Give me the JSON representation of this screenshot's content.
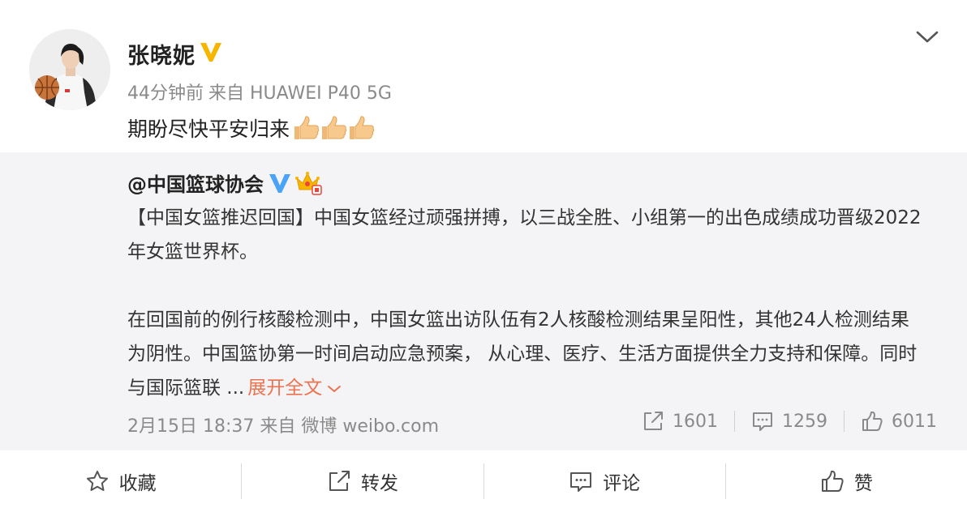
{
  "post": {
    "author": "张晓妮",
    "time": "44分钟前",
    "source": "来自 HUAWEI P40 5G",
    "text": "期盼尽快平安归来",
    "emoji_count": 3
  },
  "retweet": {
    "author": "@中国篮球协会",
    "paragraph1": "【中国女篮推迟回国】中国女篮经过顽强拼搏，以三战全胜、小组第一的出色成绩成功晋级2022年女篮世界杯。",
    "paragraph2": "在回国前的例行核酸检测中，中国女篮出访队伍有2人核酸检测结果呈阳性，其他24人检测结果为阴性。中国篮协第一时间启动应急预案， 从心理、医疗、生活方面提供全力支持和保障。同时与国际篮联 ...",
    "expand_label": "展开全文",
    "timestamp": "2月15日 18:37 来自 微博 weibo.com",
    "reposts": "1601",
    "comments": "1259",
    "likes": "6011"
  },
  "actions": {
    "favorite": "收藏",
    "repost": "转发",
    "comment": "评论",
    "like": "赞"
  },
  "colors": {
    "accent": "#eb7350",
    "vip_gold": "#f7b500",
    "vip_blue": "#4aa3f4",
    "retweet_bg": "#f4f4f6",
    "meta_gray": "#8a8a8a"
  },
  "icons": [
    "chevron-down-icon",
    "vip-badge-icon",
    "thumbs-up-emoji",
    "crown-icon",
    "repost-icon",
    "comment-icon",
    "like-icon",
    "star-icon"
  ]
}
